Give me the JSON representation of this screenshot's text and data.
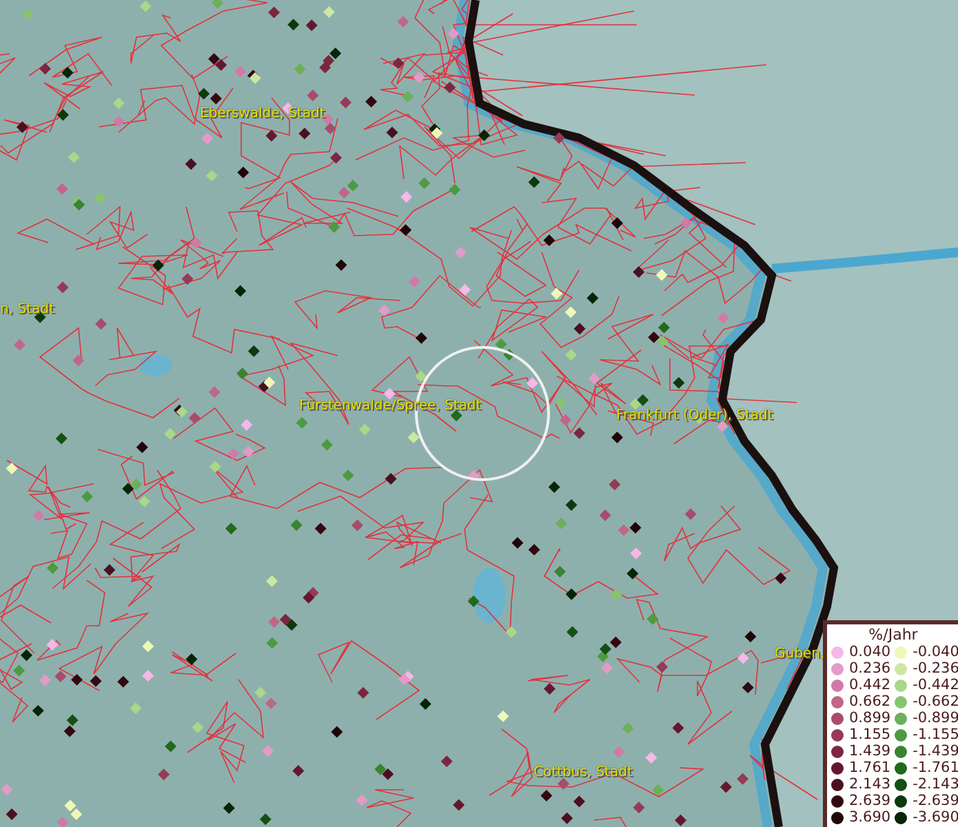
{
  "map": {
    "labels": [
      {
        "text": "Eberswalde, Stadt"
      },
      {
        "text": "n, Stadt"
      },
      {
        "text": "Fürstenwalde/Spree, Stadt"
      },
      {
        "text": "Frankfurt (Oder), Stadt"
      },
      {
        "text": "Guben,"
      },
      {
        "text": "Cottbus, Stadt"
      }
    ]
  },
  "legend": {
    "title": "%/Jahr",
    "entries": [
      {
        "value": "0.040",
        "color": "#f5b8e8"
      },
      {
        "value": "-0.040",
        "color": "#eef8b8"
      },
      {
        "value": "0.236",
        "color": "#e49ac8"
      },
      {
        "value": "-0.236",
        "color": "#cce8a0"
      },
      {
        "value": "0.442",
        "color": "#d07aa8"
      },
      {
        "value": "-0.442",
        "color": "#a8d888"
      },
      {
        "value": "0.662",
        "color": "#c06688"
      },
      {
        "value": "-0.662",
        "color": "#88c470"
      },
      {
        "value": "0.899",
        "color": "#a84c6c"
      },
      {
        "value": "-0.899",
        "color": "#6cb058"
      },
      {
        "value": "1.155",
        "color": "#963a56"
      },
      {
        "value": "-1.155",
        "color": "#4e9a40"
      },
      {
        "value": "1.439",
        "color": "#7c2640"
      },
      {
        "value": "-1.439",
        "color": "#3a8430"
      },
      {
        "value": "1.761",
        "color": "#641830"
      },
      {
        "value": "-1.761",
        "color": "#226a1c"
      },
      {
        "value": "2.143",
        "color": "#4a1020"
      },
      {
        "value": "-2.143",
        "color": "#145014"
      },
      {
        "value": "2.639",
        "color": "#340810"
      },
      {
        "value": "-2.639",
        "color": "#0c3a0c"
      },
      {
        "value": "3.690",
        "color": "#200408"
      },
      {
        "value": "-3.690",
        "color": "#062406"
      }
    ]
  }
}
